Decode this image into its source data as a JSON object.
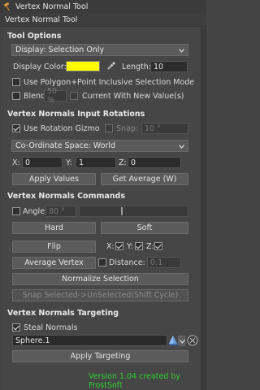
{
  "window": {
    "title": "Vertex Normal Tool",
    "icon": "hammer-icon"
  },
  "panel_header": "Vertex Normal Tool",
  "tool_options": {
    "heading": "Tool Options",
    "display_mode": "Display: Selection Only",
    "display_color_label": "Display Color:",
    "display_color": "#ffff00",
    "length_label": "Length:",
    "length_value": "10",
    "use_inclusive_label": "Use Polygon+Point Inclusive Selection Mode",
    "blend_label": "Blend",
    "blend_value": "50 %",
    "current_with_new_label": "Current With New Value(s)"
  },
  "input_rotations": {
    "heading": "Vertex Normals Input Rotations",
    "use_gizmo_label": "Use Rotation Gizmo",
    "snap_label": "Snap:",
    "snap_value": "10 °",
    "coord_space": "Co-Ordinate Space: World",
    "x_label": "X:",
    "x_value": "0",
    "y_label": "Y:",
    "y_value": "1",
    "z_label": "Z:",
    "z_value": "0",
    "apply_values": "Apply Values",
    "get_average": "Get Average (W)"
  },
  "commands": {
    "heading": "Vertex Normals Commands",
    "angle_label": "Angle",
    "angle_value": "80 °",
    "angle_fraction": 0.39,
    "hard": "Hard",
    "soft": "Soft",
    "flip": "Flip",
    "flip_x_label": "X:",
    "flip_y_label": "Y:",
    "flip_z_label": "Z:",
    "average_vertex": "Average Vertex",
    "distance_label": "Distance:",
    "distance_value": "0.1",
    "normalize_selection": "Normalize Selection",
    "snap_selected": "Snap Selected->UnSelected(Shift Cycle)"
  },
  "targeting": {
    "heading": "Vertex Normals Targeting",
    "steal_normals_label": "Steal Normals",
    "target_object": "Sphere.1",
    "apply_targeting": "Apply Targeting"
  },
  "footer": "Version 1.04 created by FrostSoft",
  "colors": {
    "footer_green": "#2fd02f",
    "swatch_yellow": "#ffff00"
  }
}
